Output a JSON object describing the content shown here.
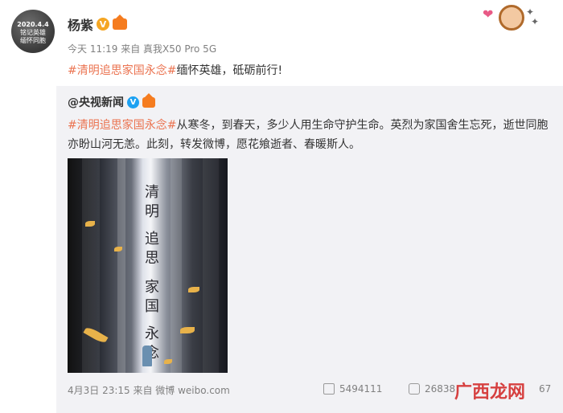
{
  "author": {
    "name": "杨紫",
    "avatar_lines": [
      "2020.4.4",
      "铭记英雄",
      "缅怀同胞"
    ],
    "verified_icon": "verified-v-icon",
    "vip_icon": "crown-icon"
  },
  "post": {
    "meta": "今天 11:19 来自 真我X50 Pro 5G",
    "topic": "#清明追思家国永念#",
    "text": "缅怀英雄，砥砺前行!"
  },
  "repost": {
    "user": "@央视新闻",
    "topic": "#清明追思家国永念#",
    "text": "从寒冬，到春天，多少人用生命守护生命。英烈为家国舍生忘死，逝世同胞亦盼山河无恙。此刻，转发微博，愿花飨逝者、春暖斯人。",
    "poster_col_1": "清明",
    "poster_col_2": "追思",
    "poster_col_3": "家国",
    "poster_col_4": "永念",
    "meta": "4月3日 23:15 来自 微博 weibo.com",
    "reposts": "5494111",
    "comments": "26838",
    "likes_partial": "67"
  },
  "watermark": "广西龙网",
  "colors": {
    "topic": "#eb7350",
    "meta": "#808080",
    "repost_bg": "#f2f2f5"
  }
}
